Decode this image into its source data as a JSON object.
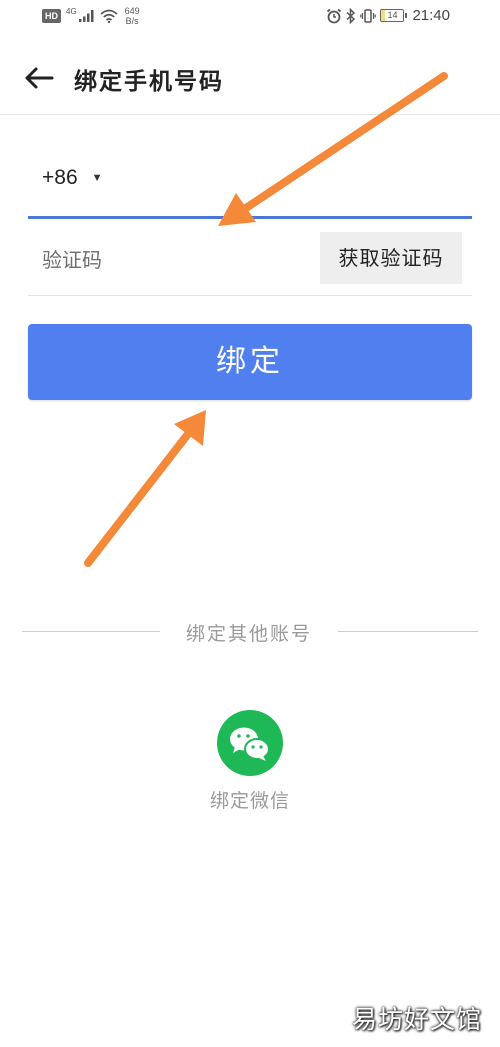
{
  "status_bar": {
    "hd": "HD",
    "network": "4G",
    "speed_value": "649",
    "speed_unit": "B/s",
    "battery": "14",
    "battery_level": 0.14,
    "time": "21:40"
  },
  "header": {
    "title": "绑定手机号码"
  },
  "form": {
    "country_code": "+86",
    "phone_placeholder": "",
    "code_placeholder": "验证码",
    "get_code_label": "获取验证码",
    "submit_label": "绑定"
  },
  "other_accounts": {
    "label": "绑定其他账号",
    "wechat_label": "绑定微信"
  },
  "watermark": "易坊好文馆",
  "colors": {
    "accent": "#507ff0",
    "underline_active": "#4a76d7",
    "wechat": "#1fb857",
    "annotation_arrow": "#f5893a"
  }
}
